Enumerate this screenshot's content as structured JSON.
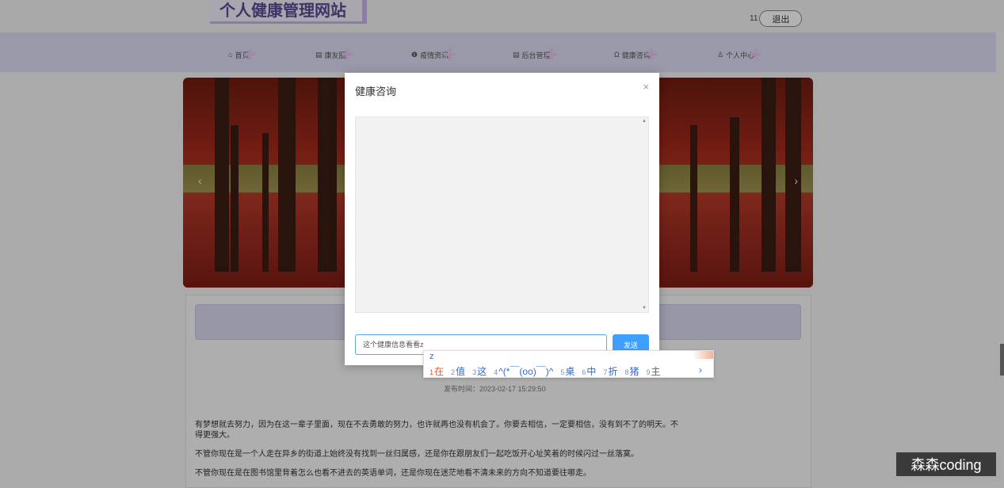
{
  "site": {
    "title": "个人健康管理网站",
    "user_name": "11",
    "logout_label": "退出"
  },
  "nav": [
    {
      "label": "首页",
      "icon": "home-icon",
      "glyph": "⌂"
    },
    {
      "label": "康友圈",
      "icon": "doc-icon",
      "glyph": "▤"
    },
    {
      "label": "疫情资讯",
      "icon": "info-icon",
      "glyph": "❶"
    },
    {
      "label": "后台管理",
      "icon": "admin-icon",
      "glyph": "▤"
    },
    {
      "label": "健康咨询",
      "icon": "headset-icon",
      "glyph": "Ω"
    },
    {
      "label": "个人中心",
      "icon": "user-icon",
      "glyph": "♙"
    }
  ],
  "banner": {
    "prev_glyph": "‹",
    "next_glyph": "›"
  },
  "article": {
    "publish_time": "发布时间：2023-02-17 15:29:50",
    "paragraphs": [
      "有梦想就去努力，因为在这一辈子里面，现在不去勇敢的努力，也许就再也没有机会了。你要去相信，一定要相信，没有到不了的明天。不",
      "得更强大。",
      "不管你现在是一个人走在异乡的街道上始终没有找到一丝归属感，还是你在跟朋友们一起吃饭开心址笑着的时候闪过一丝落寞。",
      "不管你现在是在图书馆里背着怎么也看不进去的英语单词，还是你现在迷茫地看不清未来的方向不知道要往哪走。"
    ]
  },
  "modal": {
    "title": "健康咨询",
    "close_glyph": "×",
    "input_value": "这个健康信息看看z",
    "send_label": "发送"
  },
  "ime": {
    "composition": "z",
    "candidates": [
      {
        "num": "1",
        "text": "在"
      },
      {
        "num": "2",
        "text": "值"
      },
      {
        "num": "3",
        "text": "这"
      },
      {
        "num": "4",
        "text": "^(*￣(oo)￣)^"
      },
      {
        "num": "5",
        "text": "桌"
      },
      {
        "num": "6",
        "text": "中"
      },
      {
        "num": "7",
        "text": "折"
      },
      {
        "num": "8",
        "text": "猪"
      },
      {
        "num": "9",
        "text": "主"
      }
    ],
    "more_glyph": "›"
  },
  "watermark": "森森coding"
}
